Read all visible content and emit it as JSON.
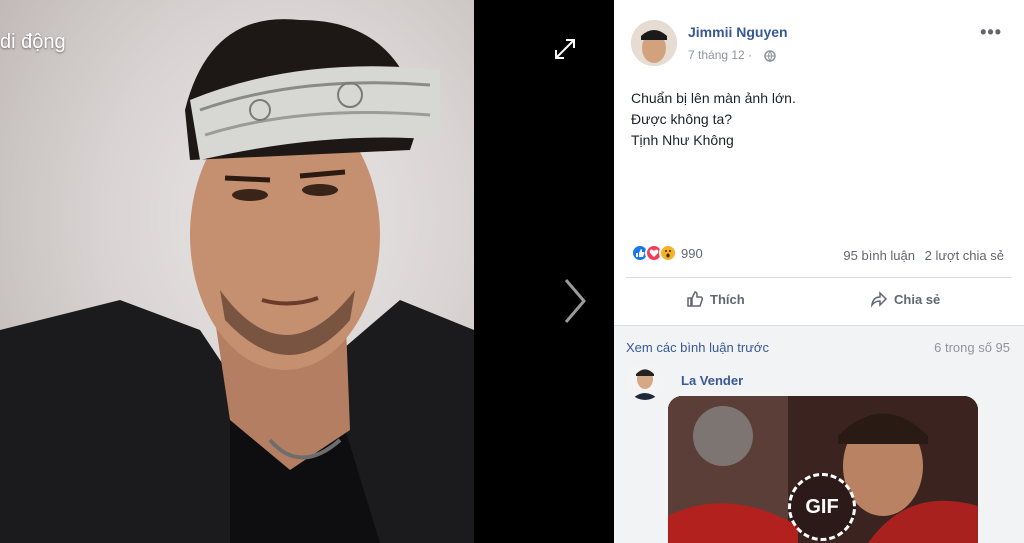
{
  "viewer": {
    "caption": "di động"
  },
  "post": {
    "author": "Jimmii Nguyen",
    "time": "7 tháng 12 ·",
    "more": "•••",
    "lines": [
      "Chuẩn bị lên màn ảnh lớn.",
      "Được không ta?",
      "Tịnh Như Không"
    ],
    "reaction_count": "990",
    "comments_count": "95 bình luận",
    "shares_count": "2 lượt chia sẻ",
    "like_label": "Thích",
    "share_label": "Chia sẻ"
  },
  "comments": {
    "view_previous": "Xem các bình luận trước",
    "count_of": "6 trong số 95",
    "first": {
      "author": "La Vender",
      "gif_label": "GIF"
    }
  },
  "colors": {
    "link": "#385898",
    "like_blue": "#1877f2",
    "love_red": "#f33e58",
    "wow_yellow": "#f7b125"
  }
}
